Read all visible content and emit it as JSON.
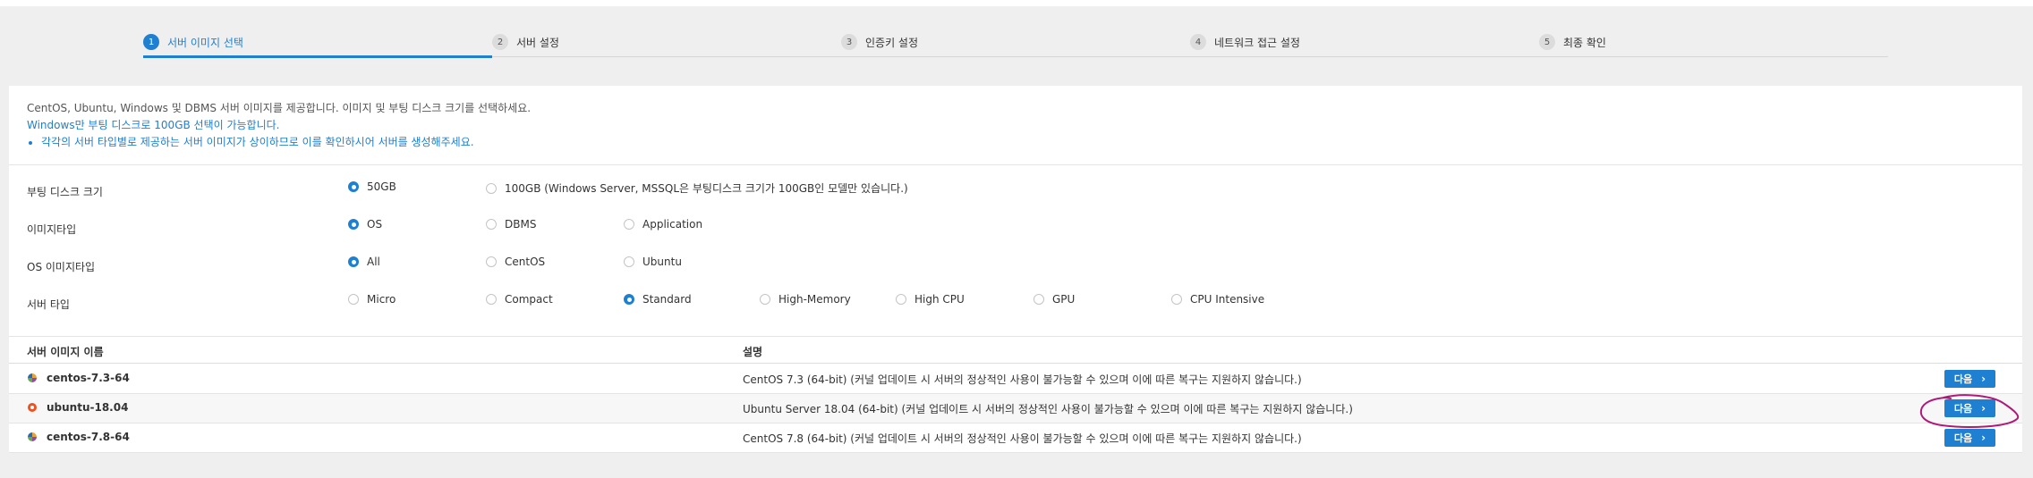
{
  "stepper": {
    "steps": [
      {
        "num": "1",
        "label": "서버 이미지 선택",
        "active": true
      },
      {
        "num": "2",
        "label": "서버 설정",
        "active": false
      },
      {
        "num": "3",
        "label": "인증키 설정",
        "active": false
      },
      {
        "num": "4",
        "label": "네트워크 접근 설정",
        "active": false
      },
      {
        "num": "5",
        "label": "최종 확인",
        "active": false
      }
    ]
  },
  "info": {
    "line1": "CentOS, Ubuntu, Windows 및 DBMS 서버 이미지를 제공합니다. 이미지 및 부팅 디스크 크기를 선택하세요.",
    "line2": "Windows만 부팅 디스크로 100GB 선택이 가능합니다.",
    "bullet": "각각의 서버 타입별로 제공하는 서버 이미지가 상이하므로 이를 확인하시어 서버를 생성해주세요."
  },
  "options": {
    "boot_disk": {
      "label": "부팅 디스크 크기",
      "choices": [
        "50GB",
        "100GB (Windows Server, MSSQL은 부팅디스크 크기가 100GB인 모델만 있습니다.)"
      ],
      "selected": "50GB"
    },
    "image_type": {
      "label": "이미지타입",
      "choices": [
        "OS",
        "DBMS",
        "Application"
      ],
      "selected": "OS"
    },
    "os_image_type": {
      "label": "OS 이미지타입",
      "choices": [
        "All",
        "CentOS",
        "Ubuntu"
      ],
      "selected": "All"
    },
    "server_type": {
      "label": "서버 타입",
      "choices": [
        "Micro",
        "Compact",
        "Standard",
        "High-Memory",
        "High CPU",
        "GPU",
        "CPU Intensive"
      ],
      "selected": "Standard"
    }
  },
  "table": {
    "headers": {
      "name": "서버 이미지 이름",
      "desc": "설명"
    },
    "rows": [
      {
        "icon": "centos-icon",
        "name": "centos-7.3-64",
        "desc": "CentOS 7.3 (64-bit) (커널 업데이트 시 서버의 정상적인 사용이 불가능할 수 있으며 이에 따른 복구는 지원하지 않습니다.)",
        "button": "다음"
      },
      {
        "icon": "ubuntu-icon",
        "name": "ubuntu-18.04",
        "desc": "Ubuntu Server 18.04 (64-bit) (커널 업데이트 시 서버의 정상적인 사용이 불가능할 수 있으며 이에 따른 복구는 지원하지 않습니다.)",
        "button": "다음"
      },
      {
        "icon": "centos-icon",
        "name": "centos-7.8-64",
        "desc": "CentOS 7.8 (64-bit) (커널 업데이트 시 서버의 정상적인 사용이 불가능할 수 있으며 이에 따른 복구는 지원하지 않습니다.)",
        "button": "다음"
      }
    ]
  },
  "colors": {
    "accent": "#1f7fd0",
    "annotation": "#b0187a",
    "page_bg": "#efefef"
  }
}
